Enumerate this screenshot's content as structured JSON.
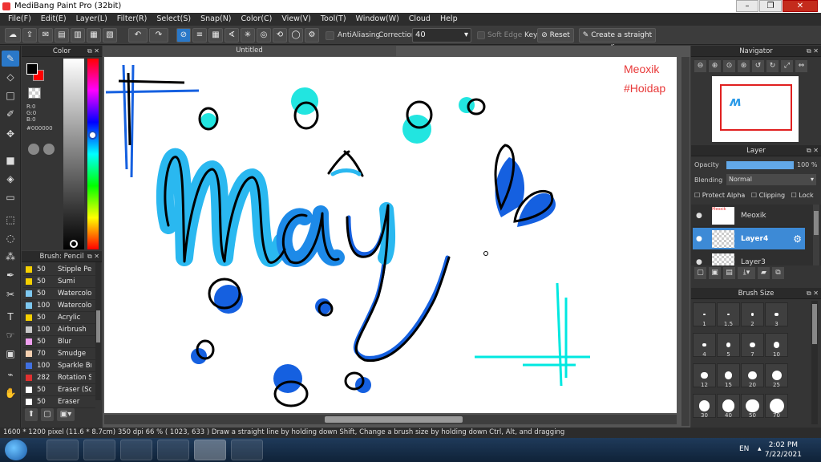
{
  "window": {
    "title": "MediBang Paint Pro (32bit)",
    "min": "0",
    "max": "1",
    "close": "r"
  },
  "menu": [
    "File(F)",
    "Edit(E)",
    "Layer(L)",
    "Filter(R)",
    "Select(S)",
    "Snap(N)",
    "Color(C)",
    "View(V)",
    "Tool(T)",
    "Window(W)",
    "Cloud",
    "Help"
  ],
  "toolbar": {
    "antialiasing_label": "AntiAliasing",
    "correction_label": "Correction",
    "correction_value": "40",
    "soft_edge_label": "Soft Edge",
    "key_label": "Key",
    "reset_label": "Reset",
    "straight_line_label": "Create a straight line"
  },
  "color_panel": {
    "title": "Color",
    "r": "R:0",
    "g": "G:0",
    "b": "B:0",
    "hex": "#000000",
    "primary_color": "#000000",
    "secondary_color": "#ff0000"
  },
  "brush_panel": {
    "title": "Brush: Pencil",
    "items": [
      {
        "size": "50",
        "name": "Stipple Pe",
        "color": "#f5d000"
      },
      {
        "size": "50",
        "name": "Sumi",
        "color": "#f5d000"
      },
      {
        "size": "50",
        "name": "Watercolo",
        "color": "#7ec8f0"
      },
      {
        "size": "100",
        "name": "Watercolo",
        "color": "#7ec8f0"
      },
      {
        "size": "50",
        "name": "Acrylic",
        "color": "#f5d000"
      },
      {
        "size": "100",
        "name": "Airbrush",
        "color": "#c8c8c8"
      },
      {
        "size": "50",
        "name": "Blur",
        "color": "#f0a0f0"
      },
      {
        "size": "70",
        "name": "Smudge",
        "color": "#f5d0b0"
      },
      {
        "size": "100",
        "name": "Sparkle Br",
        "color": "#4070e0"
      },
      {
        "size": "282",
        "name": "Rotation S",
        "color": "#e03030"
      },
      {
        "size": "50",
        "name": "Eraser (Sc",
        "color": "#ffffff"
      },
      {
        "size": "50",
        "name": "Eraser",
        "color": "#ffffff"
      }
    ]
  },
  "document": {
    "tab_title": "Untitled"
  },
  "canvas": {
    "watermark_line1": "Meoxik",
    "watermark_line2": "#Hoidap"
  },
  "navigator": {
    "title": "Navigator"
  },
  "layer_panel": {
    "title": "Layer",
    "opacity_label": "Opacity",
    "opacity_value": "100 %",
    "opacity_fraction": 1.0,
    "blending_label": "Blending",
    "blending_value": "Normal",
    "protect_alpha": "Protect Alpha",
    "clipping": "Clipping",
    "lock": "Lock",
    "layers": [
      {
        "name": "Meoxik",
        "active": false
      },
      {
        "name": "Layer4",
        "active": true
      },
      {
        "name": "Layer3",
        "active": false
      }
    ]
  },
  "brush_size_panel": {
    "title": "Brush Size",
    "sizes": [
      "1",
      "1.5",
      "2",
      "3",
      "4",
      "5",
      "7",
      "10",
      "12",
      "15",
      "20",
      "25",
      "30",
      "40",
      "50",
      "70"
    ]
  },
  "status": {
    "text": "1600 * 1200 pixel   (11.6 * 8.7cm)   350 dpi   66 %   ( 1023, 633 )   Draw a straight line by holding down Shift, Change a brush size by holding down Ctrl, Alt, and dragging"
  },
  "taskbar": {
    "lang": "EN",
    "time": "2:02 PM",
    "date": "7/22/2021"
  },
  "colors": {
    "accent": "#3d8ad6",
    "cyan": "#00e5e0",
    "blue": "#1560e0"
  }
}
